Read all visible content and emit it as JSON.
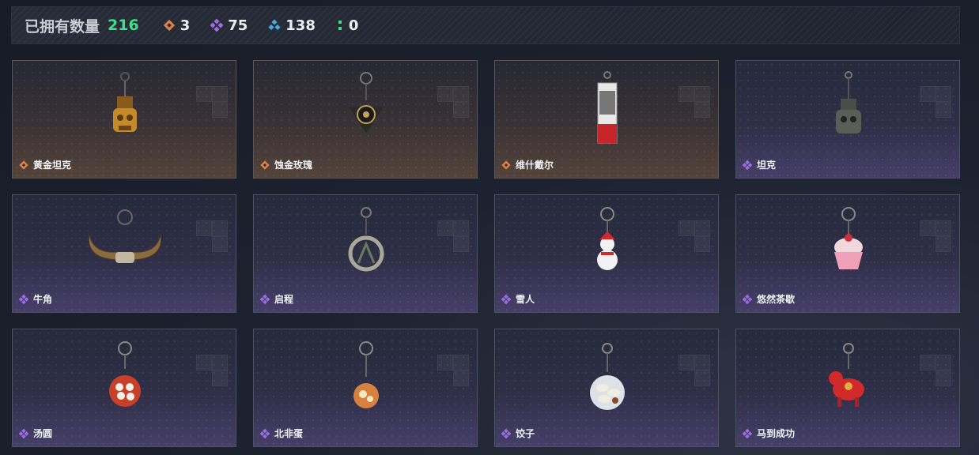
{
  "header": {
    "title": "已拥有数量",
    "total": "216",
    "stats": [
      {
        "icon": "orange-diamond-icon",
        "value": "3",
        "color": "#e08a4a"
      },
      {
        "icon": "purple-diamond-icon",
        "value": "75",
        "color": "#9a6de0"
      },
      {
        "icon": "blue-triad-icon",
        "value": "138",
        "color": "#4aa8e0"
      },
      {
        "icon": "green-dots-icon",
        "value": "0",
        "color": "#3fe08a"
      }
    ]
  },
  "cards": [
    {
      "name": "黄金坦克",
      "rarity": "orange"
    },
    {
      "name": "蚀金玫瑰",
      "rarity": "orange"
    },
    {
      "name": "维什戴尔",
      "rarity": "orange"
    },
    {
      "name": "坦克",
      "rarity": "purple"
    },
    {
      "name": "牛角",
      "rarity": "purple"
    },
    {
      "name": "启程",
      "rarity": "purple"
    },
    {
      "name": "雪人",
      "rarity": "purple"
    },
    {
      "name": "悠然茶歇",
      "rarity": "purple"
    },
    {
      "name": "汤圆",
      "rarity": "purple"
    },
    {
      "name": "北非蛋",
      "rarity": "purple"
    },
    {
      "name": "饺子",
      "rarity": "purple"
    },
    {
      "name": "马到成功",
      "rarity": "purple"
    }
  ]
}
